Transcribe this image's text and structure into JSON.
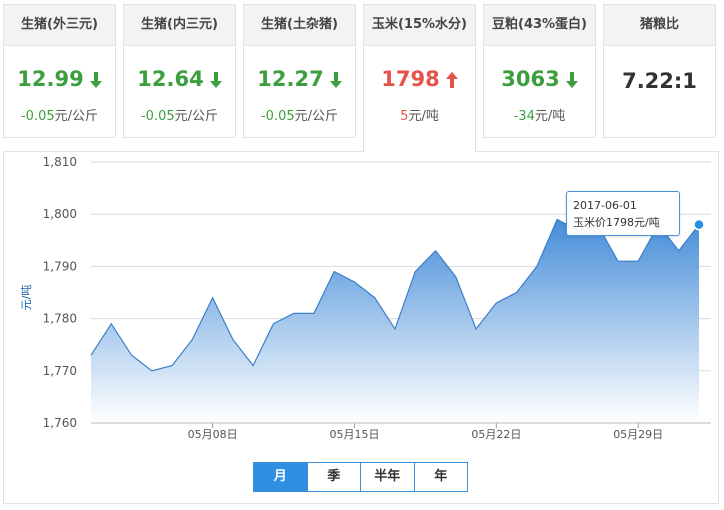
{
  "cards": [
    {
      "title": "生猪(外三元)",
      "value": "12.99",
      "change": "-0.05",
      "unit": "元/公斤",
      "trend": "down"
    },
    {
      "title": "生猪(内三元)",
      "value": "12.64",
      "change": "-0.05",
      "unit": "元/公斤",
      "trend": "down"
    },
    {
      "title": "生猪(土杂猪)",
      "value": "12.27",
      "change": "-0.05",
      "unit": "元/公斤",
      "trend": "down"
    },
    {
      "title": "玉米(15%水分)",
      "value": "1798",
      "change": "5",
      "unit": "元/吨",
      "trend": "up",
      "active": true
    },
    {
      "title": "豆粕(43%蛋白)",
      "value": "3063",
      "change": "-34",
      "unit": "元/吨",
      "trend": "down"
    },
    {
      "title": "猪粮比",
      "value": "7.22:1",
      "change": "",
      "unit": "",
      "trend": "none"
    }
  ],
  "colors": {
    "down": "#3c9e3c",
    "up": "#e5534b",
    "accent": "#2d8fe2"
  },
  "tooltip": {
    "date": "2017-06-01",
    "text": "玉米价1798元/吨"
  },
  "periods": [
    {
      "label": "月",
      "active": true
    },
    {
      "label": "季",
      "active": false
    },
    {
      "label": "半年",
      "active": false
    },
    {
      "label": "年",
      "active": false
    }
  ],
  "chart_data": {
    "type": "area",
    "title": "",
    "xlabel": "",
    "ylabel": "元/吨",
    "ylim": [
      1760,
      1810
    ],
    "yticks": [
      "1,760",
      "1,770",
      "1,780",
      "1,790",
      "1,800",
      "1,810"
    ],
    "ytick_values": [
      1760,
      1770,
      1780,
      1790,
      1800,
      1810
    ],
    "xtick_labels": [
      "05月08日",
      "05月15日",
      "05月22日",
      "05月29日"
    ],
    "xtick_dates": [
      "2017-05-08",
      "2017-05-15",
      "2017-05-22",
      "2017-05-29"
    ],
    "grid": true,
    "series": [
      {
        "x": [
          "2017-05-02",
          "2017-05-03",
          "2017-05-04",
          "2017-05-05",
          "2017-05-06",
          "2017-05-07",
          "2017-05-08",
          "2017-05-09",
          "2017-05-10",
          "2017-05-11",
          "2017-05-12",
          "2017-05-13",
          "2017-05-14",
          "2017-05-15",
          "2017-05-16",
          "2017-05-17",
          "2017-05-18",
          "2017-05-19",
          "2017-05-20",
          "2017-05-21",
          "2017-05-22",
          "2017-05-23",
          "2017-05-24",
          "2017-05-25",
          "2017-05-26",
          "2017-05-27",
          "2017-05-28",
          "2017-05-29",
          "2017-05-30",
          "2017-05-31",
          "2017-06-01"
        ],
        "values": [
          1773,
          1779,
          1773,
          1770,
          1771,
          1776,
          1784,
          1776,
          1771,
          1779,
          1781,
          1781,
          1789,
          1787,
          1784,
          1778,
          1789,
          1793,
          1788,
          1778,
          1783,
          1785,
          1790,
          1799,
          1797,
          1798,
          1791,
          1791,
          1798,
          1793,
          1798
        ]
      }
    ]
  }
}
